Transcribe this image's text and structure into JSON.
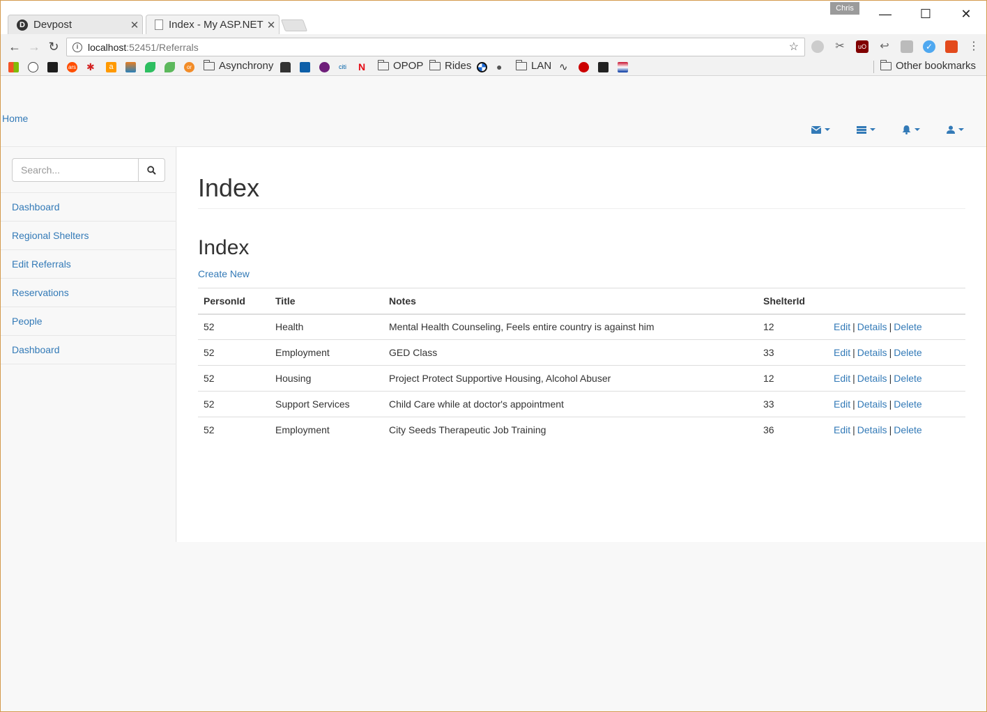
{
  "browser": {
    "tabs": [
      {
        "label": "Devpost",
        "favicon": "D",
        "active": false
      },
      {
        "label": "Index - My ASP.NET",
        "active": true
      }
    ],
    "profile_name": "Chris",
    "url_host": "localhost",
    "url_path": ":52451/Referrals",
    "bookmarks": {
      "folders": [
        "Asynchrony",
        "OPOP",
        "Rides",
        "LAN"
      ],
      "other": "Other bookmarks",
      "icon_texts": {
        "ars": "ars",
        "amazon": "a",
        "citi": "citi",
        "netflix": "N",
        "oreilly": "or"
      }
    },
    "extensions_text": {
      "ublock": "uO"
    }
  },
  "navbar": {
    "brand": "Home",
    "dropdowns": [
      "envelope",
      "tasks",
      "bell",
      "user"
    ]
  },
  "sidebar": {
    "search_placeholder": "Search...",
    "items": [
      {
        "label": "Dashboard"
      },
      {
        "label": "Regional Shelters"
      },
      {
        "label": "Edit Referrals"
      },
      {
        "label": "Reservations"
      },
      {
        "label": "People"
      },
      {
        "label": "Dashboard"
      }
    ]
  },
  "main": {
    "page_title": "Index",
    "section_title": "Index",
    "create_link": "Create New",
    "columns": [
      "PersonId",
      "Title",
      "Notes",
      "ShelterId",
      ""
    ],
    "action_labels": {
      "edit": "Edit",
      "details": "Details",
      "delete": "Delete",
      "separator": "|"
    },
    "rows": [
      {
        "person_id": "52",
        "title": "Health",
        "notes": "Mental Health Counseling, Feels entire country is against him",
        "shelter_id": "12"
      },
      {
        "person_id": "52",
        "title": "Employment",
        "notes": "GED Class",
        "shelter_id": "33"
      },
      {
        "person_id": "52",
        "title": "Housing",
        "notes": "Project Protect Supportive Housing, Alcohol Abuser",
        "shelter_id": "12"
      },
      {
        "person_id": "52",
        "title": "Support Services",
        "notes": "Child Care while at doctor's appointment",
        "shelter_id": "33"
      },
      {
        "person_id": "52",
        "title": "Employment",
        "notes": "City Seeds Therapeutic Job Training",
        "shelter_id": "36"
      }
    ]
  },
  "colors": {
    "link": "#337ab7",
    "text": "#333333",
    "border": "#dddddd",
    "navbar_bg": "#f8f8f8"
  }
}
